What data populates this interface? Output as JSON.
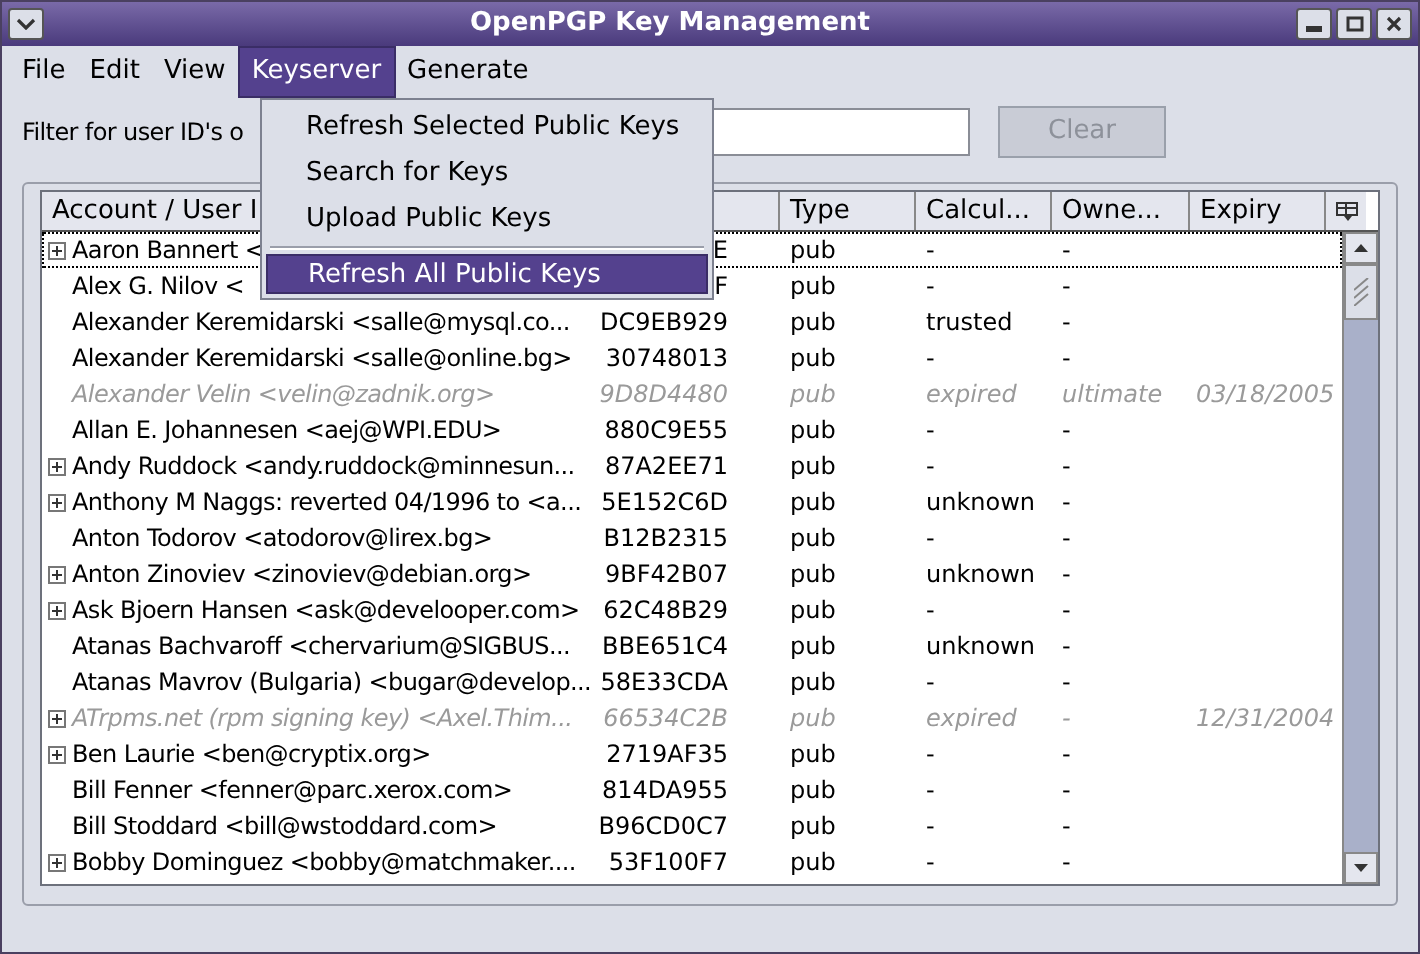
{
  "window": {
    "title": "OpenPGP Key Management"
  },
  "menubar": [
    {
      "label": "File",
      "selected": false
    },
    {
      "label": "Edit",
      "selected": false
    },
    {
      "label": "View",
      "selected": false
    },
    {
      "label": "Keyserver",
      "selected": true
    },
    {
      "label": "Generate",
      "selected": false
    }
  ],
  "menu": {
    "items": [
      {
        "kind": "item",
        "label": "Refresh Selected Public Keys",
        "selected": false
      },
      {
        "kind": "item",
        "label": "Search for Keys",
        "selected": false
      },
      {
        "kind": "item",
        "label": "Upload Public Keys",
        "selected": false
      },
      {
        "kind": "separator"
      },
      {
        "kind": "item",
        "label": "Refresh All Public Keys",
        "selected": true
      }
    ]
  },
  "filter": {
    "label": "Filter for user ID's o",
    "clear_button": {
      "label": "Clear",
      "disabled": true
    }
  },
  "table": {
    "columns": [
      "Account / User I",
      "",
      "Type",
      "Calcul...",
      "Owne...",
      "Expiry"
    ],
    "rows": [
      {
        "expander": true,
        "focused": true,
        "expired": false,
        "user": "Aaron Bannert <",
        "key": "E",
        "type": "pub",
        "calc": "-",
        "owner": "-",
        "expiry": ""
      },
      {
        "expander": false,
        "focused": false,
        "expired": false,
        "user": "Alex G. Nilov <",
        "key": "F",
        "type": "pub",
        "calc": "-",
        "owner": "-",
        "expiry": ""
      },
      {
        "expander": false,
        "focused": false,
        "expired": false,
        "user": "Alexander Keremidarski <salle@mysql.co...",
        "key": "DC9EB929",
        "type": "pub",
        "calc": "trusted",
        "owner": "-",
        "expiry": ""
      },
      {
        "expander": false,
        "focused": false,
        "expired": false,
        "user": "Alexander Keremidarski <salle@online.bg>",
        "key": "30748013",
        "type": "pub",
        "calc": "-",
        "owner": "-",
        "expiry": ""
      },
      {
        "expander": false,
        "focused": false,
        "expired": true,
        "user": "Alexander Velin <velin@zadnik.org>",
        "key": "9D8D4480",
        "type": "pub",
        "calc": "expired",
        "owner": "ultimate",
        "expiry": "03/18/2005"
      },
      {
        "expander": false,
        "focused": false,
        "expired": false,
        "user": "Allan E. Johannesen <aej@WPI.EDU>",
        "key": "880C9E55",
        "type": "pub",
        "calc": "-",
        "owner": "-",
        "expiry": ""
      },
      {
        "expander": true,
        "focused": false,
        "expired": false,
        "user": "Andy Ruddock <andy.ruddock@minnesun...",
        "key": "87A2EE71",
        "type": "pub",
        "calc": "-",
        "owner": "-",
        "expiry": ""
      },
      {
        "expander": true,
        "focused": false,
        "expired": false,
        "user": "Anthony M Naggs: reverted 04/1996 to <a...",
        "key": "5E152C6D",
        "type": "pub",
        "calc": "unknown",
        "owner": "-",
        "expiry": ""
      },
      {
        "expander": false,
        "focused": false,
        "expired": false,
        "user": "Anton Todorov <atodorov@lirex.bg>",
        "key": "B12B2315",
        "type": "pub",
        "calc": "-",
        "owner": "-",
        "expiry": ""
      },
      {
        "expander": true,
        "focused": false,
        "expired": false,
        "user": "Anton Zinoviev <zinoviev@debian.org>",
        "key": "9BF42B07",
        "type": "pub",
        "calc": "unknown",
        "owner": "-",
        "expiry": ""
      },
      {
        "expander": true,
        "focused": false,
        "expired": false,
        "user": "Ask Bjoern Hansen <ask@develooper.com>",
        "key": "62C48B29",
        "type": "pub",
        "calc": "-",
        "owner": "-",
        "expiry": ""
      },
      {
        "expander": false,
        "focused": false,
        "expired": false,
        "user": "Atanas Bachvaroff <chervarium@SIGBUS...",
        "key": "BBE651C4",
        "type": "pub",
        "calc": "unknown",
        "owner": "-",
        "expiry": ""
      },
      {
        "expander": false,
        "focused": false,
        "expired": false,
        "user": "Atanas Mavrov (Bulgaria) <bugar@develop...",
        "key": "58E33CDA",
        "type": "pub",
        "calc": "-",
        "owner": "-",
        "expiry": ""
      },
      {
        "expander": true,
        "focused": false,
        "expired": true,
        "user": "ATrpms.net (rpm signing key) <Axel.Thim...",
        "key": "66534C2B",
        "type": "pub",
        "calc": "expired",
        "owner": "-",
        "expiry": "12/31/2004"
      },
      {
        "expander": true,
        "focused": false,
        "expired": false,
        "user": "Ben Laurie <ben@cryptix.org>",
        "key": "2719AF35",
        "type": "pub",
        "calc": "-",
        "owner": "-",
        "expiry": ""
      },
      {
        "expander": false,
        "focused": false,
        "expired": false,
        "user": "Bill Fenner <fenner@parc.xerox.com>",
        "key": "814DA955",
        "type": "pub",
        "calc": "-",
        "owner": "-",
        "expiry": ""
      },
      {
        "expander": false,
        "focused": false,
        "expired": false,
        "user": "Bill Stoddard <bill@wstoddard.com>",
        "key": "B96CD0C7",
        "type": "pub",
        "calc": "-",
        "owner": "-",
        "expiry": ""
      },
      {
        "expander": true,
        "focused": false,
        "expired": false,
        "user": "Bobby Dominguez <bobby@matchmaker....",
        "key": "53F100F7",
        "type": "pub",
        "calc": "-",
        "owner": "-",
        "expiry": ""
      }
    ]
  }
}
